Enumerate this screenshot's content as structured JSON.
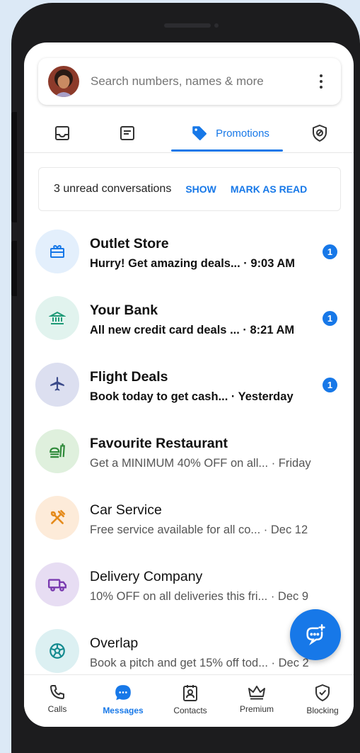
{
  "search": {
    "placeholder": "Search numbers, names & more"
  },
  "tabs": [
    {
      "icon": "inbox-icon",
      "label": ""
    },
    {
      "icon": "document-icon",
      "label": ""
    },
    {
      "icon": "tag-icon",
      "label": "Promotions",
      "active": true
    },
    {
      "icon": "shield-block-icon",
      "label": ""
    }
  ],
  "unread": {
    "text": "3 unread conversations",
    "show": "SHOW",
    "mark_read": "MARK AS READ"
  },
  "conversations": [
    {
      "title": "Outlet Store",
      "preview": "Hurry! Get amazing deals... · 9:03 AM",
      "unread": "1",
      "icon": "gift-icon",
      "bg": "#e3effc"
    },
    {
      "title": "Your Bank",
      "preview": "All new credit card deals ... · 8:21 AM",
      "unread": "1",
      "icon": "bank-icon",
      "bg": "#e1f3ee"
    },
    {
      "title": "Flight Deals",
      "preview": "Book today to get cash... · Yesterday",
      "unread": "1",
      "icon": "airplane-icon",
      "bg": "#dcdff0"
    },
    {
      "title": "Favourite Restaurant",
      "preview": "Get a MINIMUM 40% OFF on all... · Friday",
      "icon": "restaurant-icon",
      "bg": "#dff0dd"
    },
    {
      "title": "Car Service",
      "preview": "Free service available for all co... · Dec 12",
      "icon": "tools-icon",
      "bg": "#fdebd9"
    },
    {
      "title": "Delivery Company",
      "preview": "10% OFF on all deliveries this fri... · Dec 9",
      "icon": "truck-icon",
      "bg": "#e7ddf3"
    },
    {
      "title": "Overlap",
      "preview": "Book a pitch and get 15% off tod... · Dec 2",
      "icon": "soccer-ball-icon",
      "bg": "#dcf0f2"
    }
  ],
  "bottom_nav": [
    {
      "label": "Calls",
      "icon": "phone-icon"
    },
    {
      "label": "Messages",
      "icon": "chat-icon",
      "active": true
    },
    {
      "label": "Contacts",
      "icon": "contacts-icon"
    },
    {
      "label": "Premium",
      "icon": "crown-icon"
    },
    {
      "label": "Blocking",
      "icon": "shield-check-icon"
    }
  ],
  "colors": {
    "accent": "#1778e8",
    "background": "#dce9f6"
  }
}
